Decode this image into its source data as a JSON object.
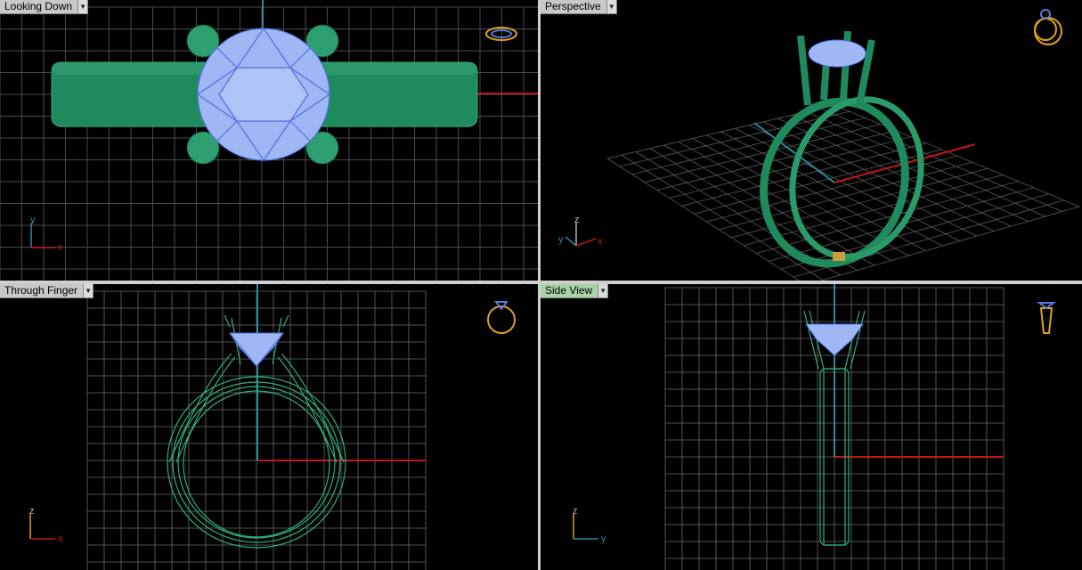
{
  "viewports": {
    "top": {
      "label": "Looking Down",
      "active": false
    },
    "perspective": {
      "label": "Perspective",
      "active": false
    },
    "front": {
      "label": "Through Finger",
      "active": false
    },
    "side": {
      "label": "Side View",
      "active": true
    }
  },
  "axes": {
    "top": {
      "v": "y",
      "h": "x"
    },
    "perspective": {
      "v": "z",
      "h": "x",
      "d": "y"
    },
    "front": {
      "v": "z",
      "h": "x"
    },
    "side": {
      "v": "z",
      "h": "y"
    }
  },
  "icons": {
    "dropdown": "chevron-down-icon",
    "view_cube": "ring-orientation-icon"
  },
  "colors": {
    "grid": "#4a4a4a",
    "grid_major": "#7a7a7a",
    "model": "#1f8a5c",
    "model_wire": "#2fb07a",
    "gem": "#9fb8f5",
    "gem_edge": "#4f6fe0",
    "axis_x": "#c01818",
    "axis_y": "#2a8aa0",
    "view_icon": "#e0a020",
    "active_tab": "#a8d3a8"
  }
}
